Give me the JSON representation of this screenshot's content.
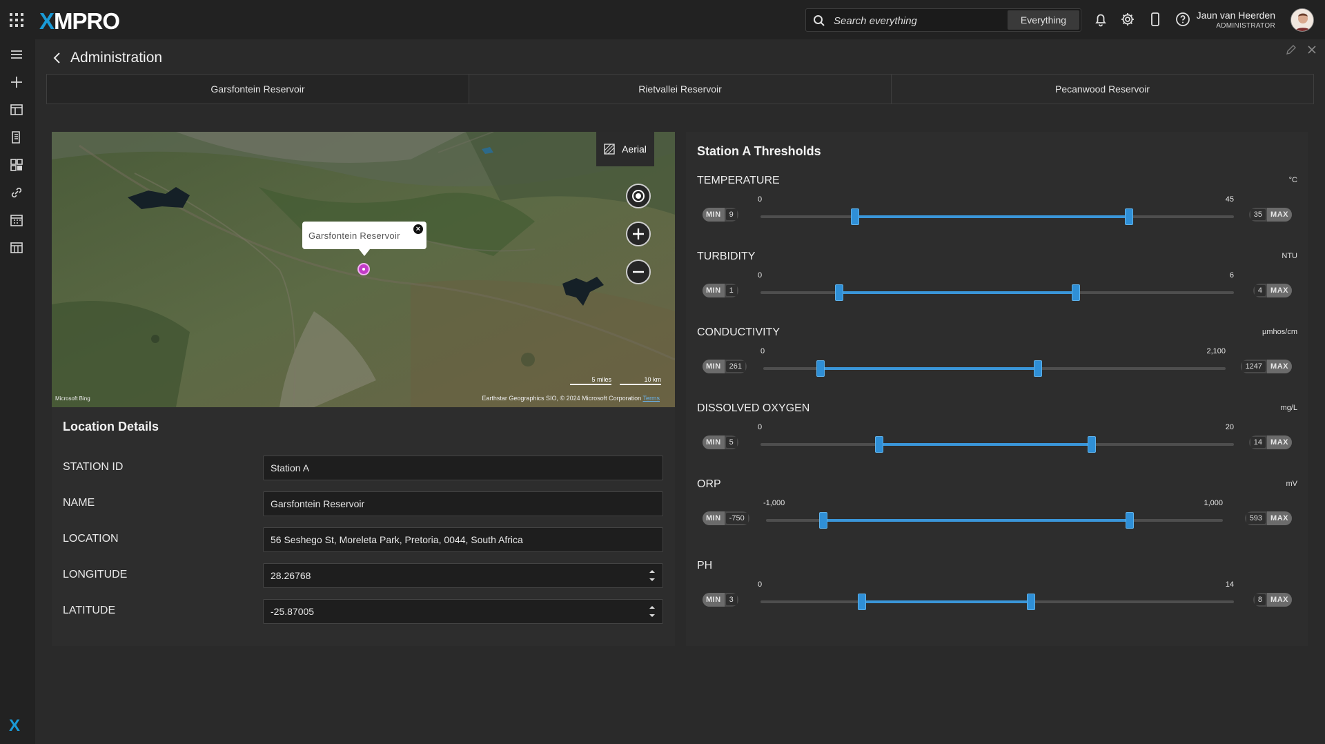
{
  "header": {
    "logo_x": "X",
    "logo_rest": "MPRO",
    "search_placeholder": "Search everything",
    "scope_label": "Everything",
    "user_name": "Jaun van Heerden",
    "user_role": "ADMINISTRATOR"
  },
  "page": {
    "title": "Administration",
    "tabs": [
      {
        "label": "Garsfontein Reservoir",
        "active": true
      },
      {
        "label": "Rietvallei Reservoir",
        "active": false
      },
      {
        "label": "Pecanwood Reservoir",
        "active": false
      }
    ]
  },
  "map": {
    "layer_label": "Aerial",
    "popup_label": "Garsfontein Reservoir",
    "popup_close": "×",
    "scale_miles": "5 miles",
    "scale_km": "10 km",
    "attribution": "Earthstar Geographics SIO, © 2024 Microsoft Corporation",
    "terms": "Terms",
    "brand": "Microsoft Bing"
  },
  "location": {
    "title": "Location Details",
    "fields": [
      {
        "label": "STATION ID",
        "value": "Station A"
      },
      {
        "label": "NAME",
        "value": "Garsfontein Reservoir"
      },
      {
        "label": "LOCATION",
        "value": "56 Seshego St, Moreleta Park, Pretoria, 0044, South Africa"
      },
      {
        "label": "LONGITUDE",
        "value": "28.26768"
      },
      {
        "label": "LATITUDE",
        "value": "-25.87005"
      }
    ]
  },
  "thresholds": {
    "title": "Station A Thresholds",
    "min_tag": "MIN",
    "max_tag": "MAX",
    "metrics": [
      {
        "name": "TEMPERATURE",
        "unit": "°C",
        "range_min": 0,
        "range_max": 45,
        "range_min_label": "0",
        "range_max_label": "45",
        "min": "9",
        "max": "35",
        "min_value": 9,
        "max_value": 35
      },
      {
        "name": "TURBIDITY",
        "unit": "NTU",
        "range_min": 0,
        "range_max": 6,
        "range_min_label": "0",
        "range_max_label": "6",
        "min": "1",
        "max": "4",
        "min_value": 1,
        "max_value": 4
      },
      {
        "name": "CONDUCTIVITY",
        "unit": "µmhos/cm",
        "range_min": 0,
        "range_max": 2100,
        "range_min_label": "0",
        "range_max_label": "2,100",
        "min": "261",
        "max": "1247",
        "min_value": 261,
        "max_value": 1247
      },
      {
        "name": "DISSOLVED OXYGEN",
        "unit": "mg/L",
        "range_min": 0,
        "range_max": 20,
        "range_min_label": "0",
        "range_max_label": "20",
        "min": "5",
        "max": "14",
        "min_value": 5,
        "max_value": 14
      },
      {
        "name": "ORP",
        "unit": "mV",
        "range_min": -1000,
        "range_max": 1000,
        "range_min_label": "-1,000",
        "range_max_label": "1,000",
        "min": "-750",
        "max": "593",
        "min_value": -750,
        "max_value": 593
      },
      {
        "name": "PH",
        "unit": "",
        "range_min": 0,
        "range_max": 14,
        "range_min_label": "0",
        "range_max_label": "14",
        "min": "3",
        "max": "8",
        "min_value": 3,
        "max_value": 8
      }
    ]
  },
  "colors": {
    "accent": "#3a96d9",
    "brand": "#1a9ad6",
    "pin": "#c33bc8"
  }
}
